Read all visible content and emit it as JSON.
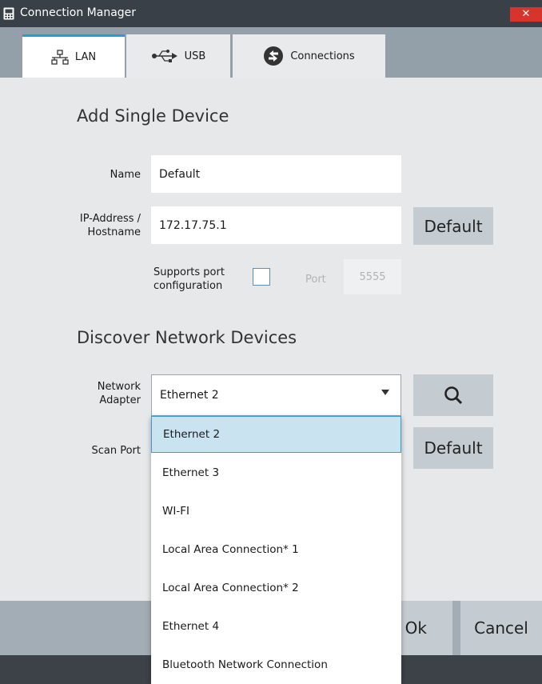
{
  "window": {
    "title": "Connection Manager",
    "close_glyph": "✕"
  },
  "tabs": [
    {
      "label": "LAN",
      "icon": "network-icon",
      "active": true
    },
    {
      "label": "USB",
      "icon": "usb-icon",
      "active": false
    },
    {
      "label": "Connections",
      "icon": "connections-icon",
      "active": false
    }
  ],
  "add_device": {
    "heading": "Add Single Device",
    "name_label": "Name",
    "name_value": "Default",
    "ip_label_line1": "IP-Address /",
    "ip_label_line2": "Hostname",
    "ip_value": "172.17.75.1",
    "default_button": "Default",
    "supports_line1": "Supports port",
    "supports_line2": "configuration",
    "supports_checked": false,
    "port_label": "Port",
    "port_value": "5555"
  },
  "discover": {
    "heading": "Discover Network Devices",
    "adapter_label_line1": "Network",
    "adapter_label_line2": "Adapter",
    "adapter_value": "Ethernet 2",
    "scan_port_label": "Scan Port",
    "default_button": "Default",
    "search_icon": "search-icon"
  },
  "dropdown": {
    "options": [
      "Ethernet 2",
      "Ethernet 3",
      "WI-FI",
      "Local Area Connection* 1",
      "Local Area Connection* 2",
      "Ethernet 4",
      "Bluetooth Network Connection"
    ],
    "selected_index": 0
  },
  "footer": {
    "ok_button": "Ok",
    "cancel_button": "Cancel"
  },
  "colors": {
    "titlebar": "#3a4047",
    "tab_strip": "#93a0aa",
    "active_tab_accent": "#1f9de0",
    "panel": "#e6e8ea",
    "button": "#c4ccd2",
    "selected_item": "#c9e3f1",
    "close": "#d9332e"
  }
}
